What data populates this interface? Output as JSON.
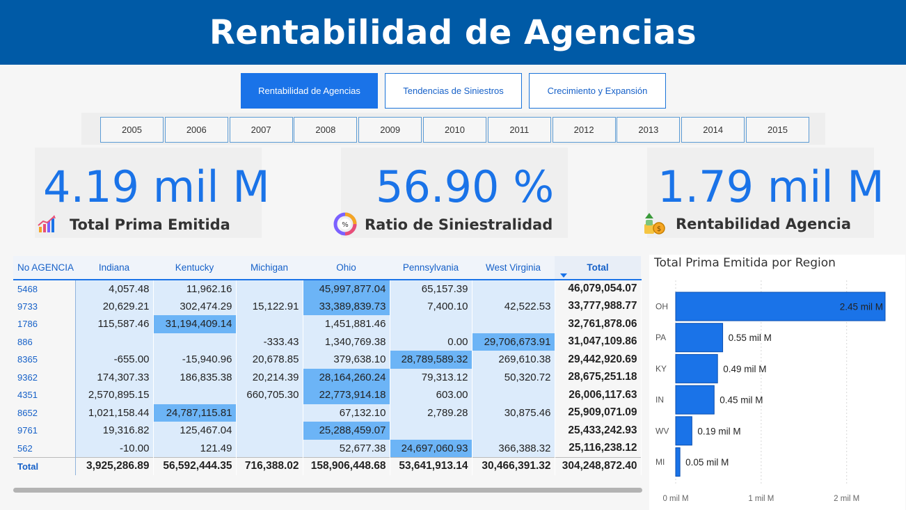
{
  "header": {
    "title": "Rentabilidad de Agencias"
  },
  "nav": [
    {
      "label": "Rentabilidad de Agencias",
      "active": true
    },
    {
      "label": "Tendencias de Siniestros",
      "active": false
    },
    {
      "label": "Crecimiento y Expansión",
      "active": false
    }
  ],
  "years": [
    "2005",
    "2006",
    "2007",
    "2008",
    "2009",
    "2010",
    "2011",
    "2012",
    "2013",
    "2014",
    "2015"
  ],
  "kpis": [
    {
      "value": "4.19 mil M",
      "label": "Total Prima Emitida",
      "icon": "growth-chart-icon"
    },
    {
      "value": "56.90 %",
      "label": "Ratio de Siniestralidad",
      "icon": "percent-donut-icon"
    },
    {
      "value": "1.79 mil M",
      "label": "Rentabilidad Agencia",
      "icon": "money-growth-icon"
    }
  ],
  "table": {
    "headers": [
      "No AGENCIA",
      "Indiana",
      "Kentucky",
      "Michigan",
      "Ohio",
      "Pennsylvania",
      "West Virginia",
      "Total"
    ],
    "rows": [
      {
        "id": "5468",
        "cells": [
          "4,057.48",
          "11,962.16",
          "",
          "45,997,877.04",
          "65,157.39",
          ""
        ],
        "total": "46,079,054.07"
      },
      {
        "id": "9733",
        "cells": [
          "20,629.21",
          "302,474.29",
          "15,122.91",
          "33,389,839.73",
          "7,400.10",
          "42,522.53"
        ],
        "total": "33,777,988.77"
      },
      {
        "id": "1786",
        "cells": [
          "115,587.46",
          "31,194,409.14",
          "",
          "1,451,881.46",
          "",
          ""
        ],
        "total": "32,761,878.06"
      },
      {
        "id": "886",
        "cells": [
          "",
          "",
          "-333.43",
          "1,340,769.38",
          "0.00",
          "29,706,673.91"
        ],
        "total": "31,047,109.86"
      },
      {
        "id": "8365",
        "cells": [
          "-655.00",
          "-15,940.96",
          "20,678.85",
          "379,638.10",
          "28,789,589.32",
          "269,610.38"
        ],
        "total": "29,442,920.69"
      },
      {
        "id": "9362",
        "cells": [
          "174,307.33",
          "186,835.38",
          "20,214.39",
          "28,164,260.24",
          "79,313.12",
          "50,320.72"
        ],
        "total": "28,675,251.18"
      },
      {
        "id": "4351",
        "cells": [
          "2,570,895.15",
          "",
          "660,705.30",
          "22,773,914.18",
          "603.00",
          ""
        ],
        "total": "26,006,117.63"
      },
      {
        "id": "8652",
        "cells": [
          "1,021,158.44",
          "24,787,115.81",
          "",
          "67,132.10",
          "2,789.28",
          "30,875.46"
        ],
        "total": "25,909,071.09"
      },
      {
        "id": "9761",
        "cells": [
          "19,316.82",
          "125,467.04",
          "",
          "25,288,459.07",
          "",
          ""
        ],
        "total": "25,433,242.93"
      },
      {
        "id": "562",
        "cells": [
          "-10.00",
          "121.49",
          "",
          "52,677.38",
          "24,697,060.93",
          "366,388.32"
        ],
        "total": "25,116,238.12"
      }
    ],
    "highlights": [
      [
        0,
        3
      ],
      [
        1,
        3
      ],
      [
        2,
        1
      ],
      [
        3,
        5
      ],
      [
        4,
        4
      ],
      [
        5,
        3
      ],
      [
        6,
        3
      ],
      [
        7,
        1
      ],
      [
        8,
        3
      ],
      [
        9,
        4
      ]
    ],
    "total_row": {
      "label": "Total",
      "cells": [
        "3,925,286.89",
        "56,592,444.35",
        "716,388.02",
        "158,906,448.68",
        "53,641,913.14",
        "30,466,391.32"
      ],
      "total": "304,248,872.40"
    }
  },
  "chart_data": {
    "type": "bar",
    "orientation": "horizontal",
    "title": "Total Prima Emitida por Region",
    "categories": [
      "OH",
      "PA",
      "KY",
      "IN",
      "WV",
      "MI"
    ],
    "values": [
      2.45,
      0.55,
      0.49,
      0.45,
      0.19,
      0.05
    ],
    "data_labels": [
      "2.45 mil M",
      "0.55 mil M",
      "0.49 mil M",
      "0.45 mil M",
      "0.19 mil M",
      "0.05 mil M"
    ],
    "x_ticks": [
      "0 mil M",
      "1 mil M",
      "2 mil M"
    ],
    "x_tick_values": [
      0,
      1,
      2
    ],
    "xlim": [
      0,
      2.45
    ],
    "grid": true,
    "bar_color": "#1a73e8"
  },
  "colors": {
    "brand": "#005aa6",
    "accent": "#1a73e8",
    "cell": "#dcebfb",
    "highlight": "#6cb4f6"
  }
}
